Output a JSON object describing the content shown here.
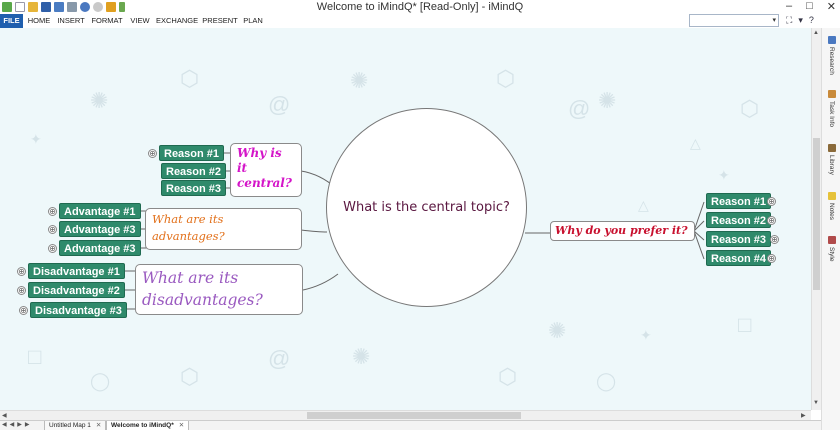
{
  "window": {
    "title": "Welcome to iMindQ* [Read-Only] - iMindQ",
    "minimize": "–",
    "maximize": "□",
    "close": "✕"
  },
  "ribbon": {
    "tabs": [
      "FILE",
      "HOME",
      "INSERT",
      "FORMAT",
      "VIEW",
      "EXCHANGE",
      "PRESENT",
      "PLAN"
    ],
    "search_value": "",
    "dropdown_glyph": "▾",
    "tool_glyphs": [
      "⛶",
      "▾",
      "?"
    ]
  },
  "mindmap": {
    "central": "What is the central topic?",
    "topics": {
      "why_central": "Why is it central?",
      "advantages": "What are its advantages?",
      "disadvantages": "What are its disadvantages?",
      "prefer": "Why do you prefer it?"
    },
    "why_reasons": [
      "Reason #1",
      "Reason #2",
      "Reason #3"
    ],
    "advantages": [
      "Advantage #1",
      "Advantage #3",
      "Advantage #3"
    ],
    "disadvantages": [
      "Disadvantage #1",
      "Disadvantage #2",
      "Disadvantage #3"
    ],
    "prefer_reasons": [
      "Reason #1",
      "Reason #2",
      "Reason #3",
      "Reason #4"
    ],
    "expand_glyph": "⊕"
  },
  "dock": {
    "items": [
      "Research",
      "Task Info",
      "Library",
      "Notes",
      "Style"
    ]
  },
  "sheets": {
    "nav_glyphs": [
      "◀",
      "◀",
      "▶",
      "▶"
    ],
    "tabs": [
      "Untitled Map 1",
      "Welcome to iMindQ*"
    ],
    "close_glyph": "✕"
  },
  "colors": {
    "ribbon_file": "#1f5fae",
    "leaf_fill": "#2f8a6b",
    "canvas_bg": "#eef8fa",
    "why_central_text": "#d414c8",
    "advantages_text": "#e2701a",
    "disadvantages_text": "#9a5ac0",
    "prefer_text": "#c8102e",
    "central_text": "#5a1740"
  }
}
